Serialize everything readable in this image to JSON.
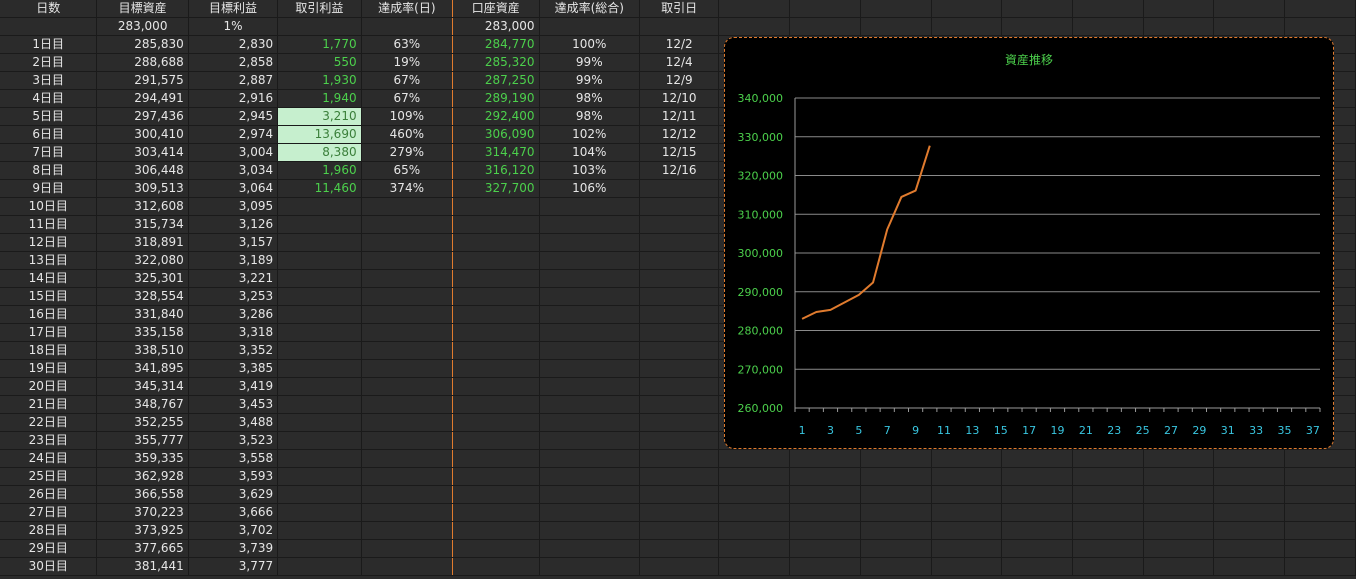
{
  "headers": [
    "日数",
    "目標資産",
    "目標利益",
    "取引利益",
    "達成率(日)",
    "口座資産",
    "達成率(総合)",
    "取引日"
  ],
  "initial_row": {
    "target_asset": "283,000",
    "target_rate": "1%",
    "account_asset": "283,000"
  },
  "rows": [
    {
      "day": "1日目",
      "target": "285,830",
      "profit_target": "2,830",
      "trade": "1,770",
      "rate_day": "63%",
      "account": "284,770",
      "rate_total": "100%",
      "date": "12/2"
    },
    {
      "day": "2日目",
      "target": "288,688",
      "profit_target": "2,858",
      "trade": "550",
      "rate_day": "19%",
      "account": "285,320",
      "rate_total": "99%",
      "date": "12/4"
    },
    {
      "day": "3日目",
      "target": "291,575",
      "profit_target": "2,887",
      "trade": "1,930",
      "rate_day": "67%",
      "account": "287,250",
      "rate_total": "99%",
      "date": "12/9"
    },
    {
      "day": "4日目",
      "target": "294,491",
      "profit_target": "2,916",
      "trade": "1,940",
      "rate_day": "67%",
      "account": "289,190",
      "rate_total": "98%",
      "date": "12/10"
    },
    {
      "day": "5日目",
      "target": "297,436",
      "profit_target": "2,945",
      "trade": "3,210",
      "rate_day": "109%",
      "account": "292,400",
      "rate_total": "98%",
      "date": "12/11"
    },
    {
      "day": "6日目",
      "target": "300,410",
      "profit_target": "2,974",
      "trade": "13,690",
      "rate_day": "460%",
      "account": "306,090",
      "rate_total": "102%",
      "date": "12/12"
    },
    {
      "day": "7日目",
      "target": "303,414",
      "profit_target": "3,004",
      "trade": "8,380",
      "rate_day": "279%",
      "account": "314,470",
      "rate_total": "104%",
      "date": "12/15"
    },
    {
      "day": "8日目",
      "target": "306,448",
      "profit_target": "3,034",
      "trade": "1,960",
      "rate_day": "65%",
      "account": "316,120",
      "rate_total": "103%",
      "date": "12/16"
    },
    {
      "day": "9日目",
      "target": "309,513",
      "profit_target": "3,064",
      "trade": "11,460",
      "rate_day": "374%",
      "account": "327,700",
      "rate_total": "106%",
      "date": ""
    },
    {
      "day": "10日目",
      "target": "312,608",
      "profit_target": "3,095",
      "trade": "",
      "rate_day": "",
      "account": "",
      "rate_total": "",
      "date": ""
    },
    {
      "day": "11日目",
      "target": "315,734",
      "profit_target": "3,126",
      "trade": "",
      "rate_day": "",
      "account": "",
      "rate_total": "",
      "date": ""
    },
    {
      "day": "12日目",
      "target": "318,891",
      "profit_target": "3,157",
      "trade": "",
      "rate_day": "",
      "account": "",
      "rate_total": "",
      "date": ""
    },
    {
      "day": "13日目",
      "target": "322,080",
      "profit_target": "3,189",
      "trade": "",
      "rate_day": "",
      "account": "",
      "rate_total": "",
      "date": ""
    },
    {
      "day": "14日目",
      "target": "325,301",
      "profit_target": "3,221",
      "trade": "",
      "rate_day": "",
      "account": "",
      "rate_total": "",
      "date": ""
    },
    {
      "day": "15日目",
      "target": "328,554",
      "profit_target": "3,253",
      "trade": "",
      "rate_day": "",
      "account": "",
      "rate_total": "",
      "date": ""
    },
    {
      "day": "16日目",
      "target": "331,840",
      "profit_target": "3,286",
      "trade": "",
      "rate_day": "",
      "account": "",
      "rate_total": "",
      "date": ""
    },
    {
      "day": "17日目",
      "target": "335,158",
      "profit_target": "3,318",
      "trade": "",
      "rate_day": "",
      "account": "",
      "rate_total": "",
      "date": ""
    },
    {
      "day": "18日目",
      "target": "338,510",
      "profit_target": "3,352",
      "trade": "",
      "rate_day": "",
      "account": "",
      "rate_total": "",
      "date": ""
    },
    {
      "day": "19日目",
      "target": "341,895",
      "profit_target": "3,385",
      "trade": "",
      "rate_day": "",
      "account": "",
      "rate_total": "",
      "date": ""
    },
    {
      "day": "20日目",
      "target": "345,314",
      "profit_target": "3,419",
      "trade": "",
      "rate_day": "",
      "account": "",
      "rate_total": "",
      "date": ""
    },
    {
      "day": "21日目",
      "target": "348,767",
      "profit_target": "3,453",
      "trade": "",
      "rate_day": "",
      "account": "",
      "rate_total": "",
      "date": ""
    },
    {
      "day": "22日目",
      "target": "352,255",
      "profit_target": "3,488",
      "trade": "",
      "rate_day": "",
      "account": "",
      "rate_total": "",
      "date": ""
    },
    {
      "day": "23日目",
      "target": "355,777",
      "profit_target": "3,523",
      "trade": "",
      "rate_day": "",
      "account": "",
      "rate_total": "",
      "date": ""
    },
    {
      "day": "24日目",
      "target": "359,335",
      "profit_target": "3,558",
      "trade": "",
      "rate_day": "",
      "account": "",
      "rate_total": "",
      "date": ""
    },
    {
      "day": "25日目",
      "target": "362,928",
      "profit_target": "3,593",
      "trade": "",
      "rate_day": "",
      "account": "",
      "rate_total": "",
      "date": ""
    },
    {
      "day": "26日目",
      "target": "366,558",
      "profit_target": "3,629",
      "trade": "",
      "rate_day": "",
      "account": "",
      "rate_total": "",
      "date": ""
    },
    {
      "day": "27日目",
      "target": "370,223",
      "profit_target": "3,666",
      "trade": "",
      "rate_day": "",
      "account": "",
      "rate_total": "",
      "date": ""
    },
    {
      "day": "28日目",
      "target": "373,925",
      "profit_target": "3,702",
      "trade": "",
      "rate_day": "",
      "account": "",
      "rate_total": "",
      "date": ""
    },
    {
      "day": "29日目",
      "target": "377,665",
      "profit_target": "3,739",
      "trade": "",
      "rate_day": "",
      "account": "",
      "rate_total": "",
      "date": ""
    },
    {
      "day": "30日目",
      "target": "381,441",
      "profit_target": "3,777",
      "trade": "",
      "rate_day": "",
      "account": "",
      "rate_total": "",
      "date": ""
    }
  ],
  "highlighted_trade_rows": [
    4,
    5,
    6
  ],
  "colors": {
    "background": "#2b2b2b",
    "gridline": "#1a1a1a",
    "text": "#e6e6e6",
    "green_text": "#4cd04c",
    "highlight_fill": "#c6efce",
    "accent_orange": "#e07b2e",
    "chart_background": "#000000",
    "chart_title": "#4cd04c",
    "chart_x_ticks": "#39c6e0",
    "chart_y_ticks": "#4cd04c",
    "line": "#e07b2e"
  },
  "chart_data": {
    "type": "line",
    "title": "資産推移",
    "xlabel": "",
    "ylabel": "",
    "ylim": [
      260000,
      340000
    ],
    "y_ticks": [
      "340,000",
      "330,000",
      "320,000",
      "310,000",
      "300,000",
      "290,000",
      "280,000",
      "270,000",
      "260,000"
    ],
    "x_ticks": [
      "1",
      "3",
      "5",
      "7",
      "9",
      "11",
      "13",
      "15",
      "17",
      "19",
      "21",
      "23",
      "25",
      "27",
      "29",
      "31",
      "33",
      "35",
      "37"
    ],
    "x_range": [
      1,
      37
    ],
    "grid": true,
    "legend": "none",
    "series": [
      {
        "x": [
          1,
          2,
          3,
          4,
          5,
          6,
          7,
          8,
          9,
          10
        ],
        "values": [
          283000,
          284770,
          285320,
          287250,
          289190,
          292400,
          306090,
          314470,
          316120,
          327700
        ]
      }
    ]
  }
}
